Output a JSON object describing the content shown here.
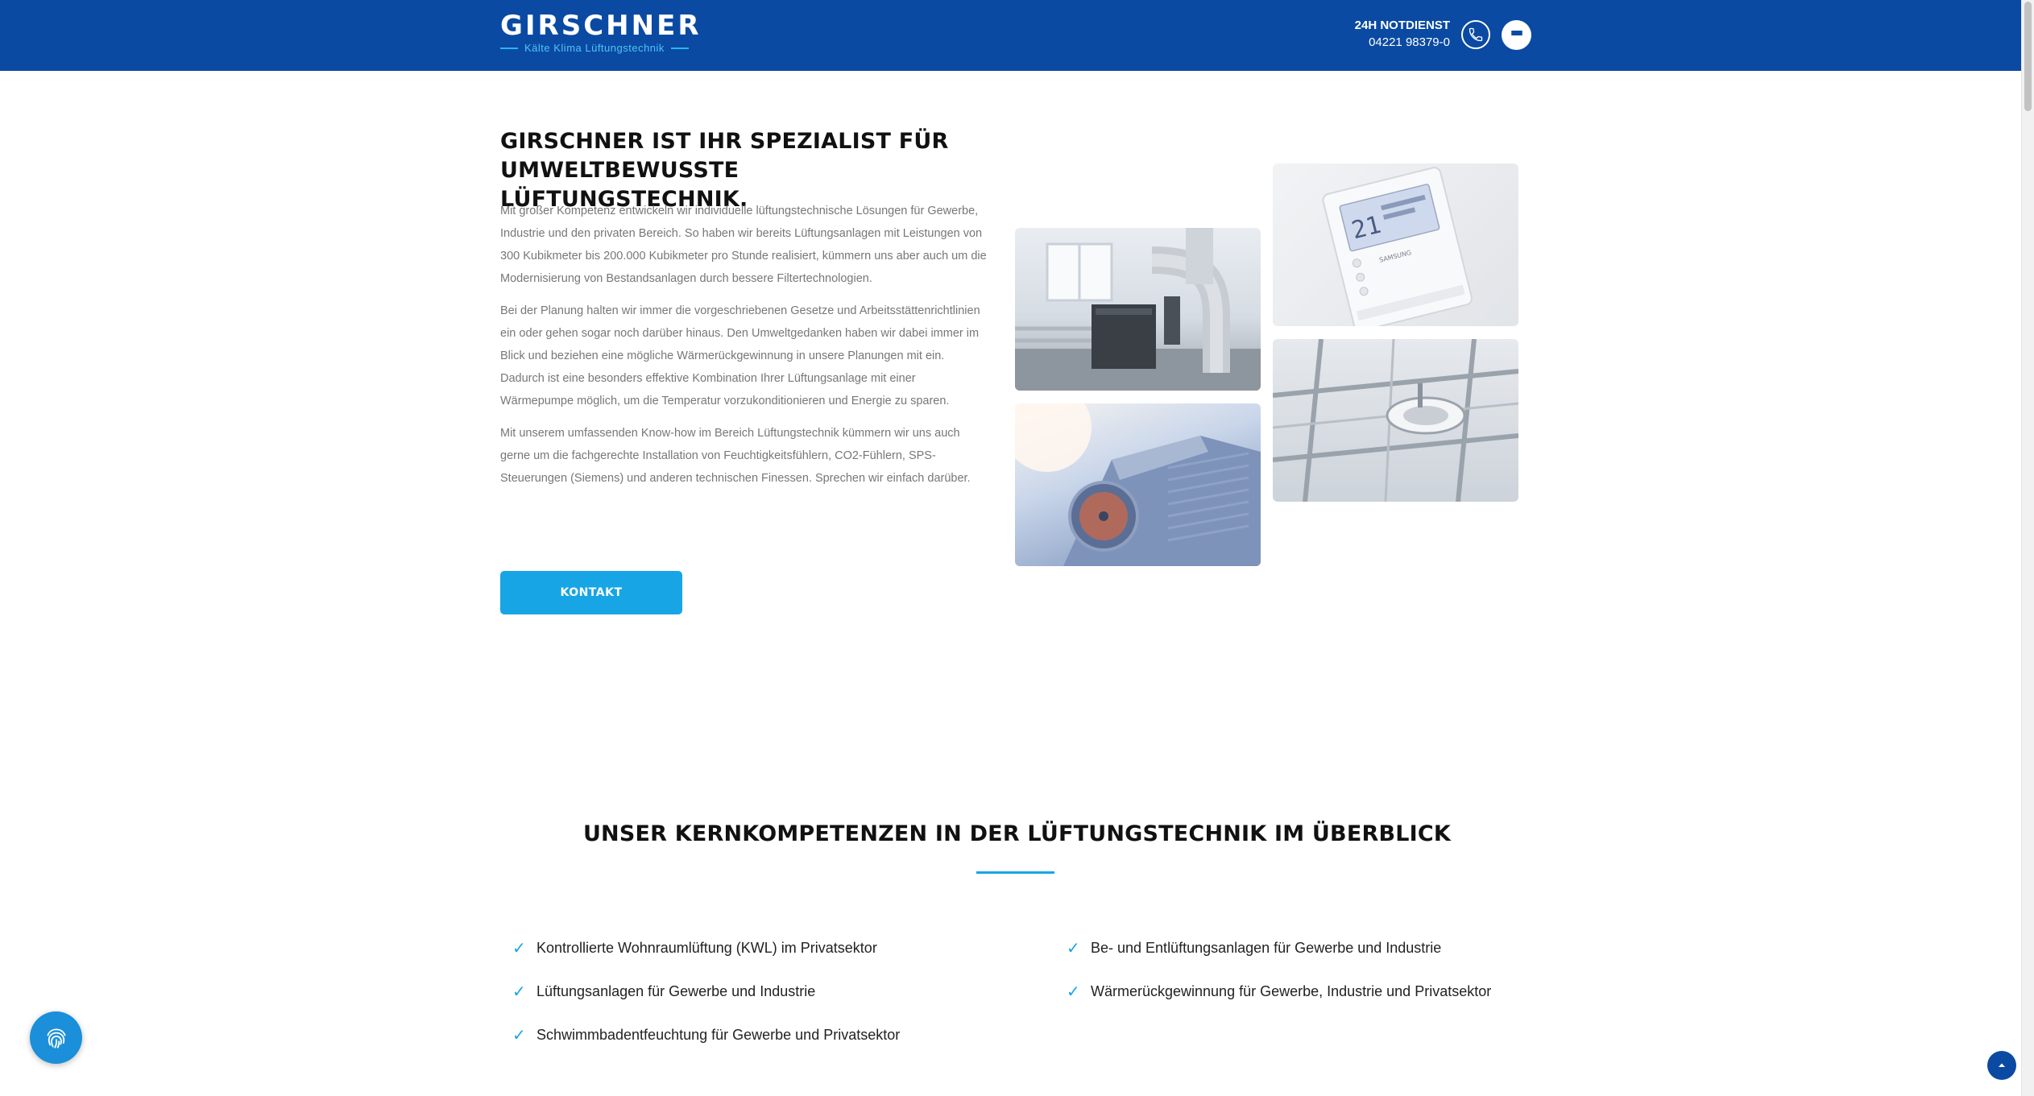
{
  "header": {
    "logo_text": "GIRSCHNER",
    "logo_tagline": "Kälte Klima Lüftungstechnik",
    "emergency_label": "24H NOTDIENST",
    "emergency_phone": "04221 98379-0",
    "phone_icon": "phone-icon",
    "menu_icon": "hamburger-menu-icon"
  },
  "intro": {
    "title": "GIRSCHNER IST IHR SPEZIALIST FÜR UMWELTBEWUSSTE LÜFTUNGSTECHNIK.",
    "paragraphs": [
      "Mit großer Kompetenz entwickeln wir individuelle lüftungstechnische Lösungen für Gewerbe, Industrie und den privaten Bereich. So haben wir bereits Lüftungsanlagen mit Leistungen von 300 Kubikmeter bis 200.000 Kubikmeter pro Stunde realisiert, kümmern uns aber auch um die Modernisierung von Bestandsanlagen durch bessere Filtertechnologien.",
      "Bei der Planung halten wir immer die vorgeschriebenen Gesetze und Arbeitsstättenrichtlinien ein oder gehen sogar noch darüber hinaus. Den Umweltgedanken haben wir dabei immer im Blick und beziehen eine mögliche Wärmerückgewinnung in unsere Planungen mit ein. Dadurch ist eine besonders effektive Kombination Ihrer Lüftungsanlage mit einer Wärmepumpe möglich, um die Temperatur vorzukonditionieren und Energie zu sparen.",
      "Mit unserem umfassenden Know-how im Bereich Lüftungstechnik kümmern wir uns auch gerne um die fachgerechte Installation von Feuchtigkeitsfühlern, CO2-Fühlern, SPS-Steuerungen (Siemens) und anderen technischen Finessen. Sprechen wir einfach darüber."
    ],
    "contact_button": "KONTAKT"
  },
  "images": {
    "thermostat_brand": "SAMSUNG",
    "thermostat_reading": "21"
  },
  "core": {
    "title": "UNSER KERNKOMPETENZEN IN DER LÜFTUNGSTECHNIK IM ÜBERBLICK",
    "check_symbol": "✓",
    "left_items": [
      "Kontrollierte Wohnraumlüftung (KWL) im Privatsektor",
      "Lüftungsanlagen für Gewerbe und Industrie",
      "Schwimmbadentfeuchtung für Gewerbe und Privatsektor"
    ],
    "right_items": [
      "Be- und Entlüftungsanlagen für Gewerbe und Industrie",
      "Wärmerückgewinnung für Gewerbe, Industrie und Privatsektor"
    ]
  },
  "floating": {
    "privacy_icon": "fingerprint-icon",
    "scroll_top_icon": "arrow-up-icon"
  },
  "colors": {
    "header_bg": "#0a4aa3",
    "accent": "#17a5e6",
    "text_muted": "#777777"
  }
}
